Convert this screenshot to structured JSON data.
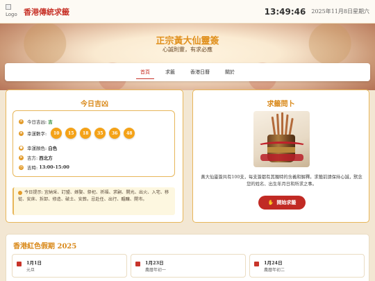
{
  "header": {
    "logo_alt": "Logo",
    "site_title": "香港傳統求籤",
    "time": "13:49:46",
    "date": "2025年11月8日星期六"
  },
  "hero": {
    "title": "正宗黃大仙靈簽",
    "subtitle": "心誠則靈，有求必應"
  },
  "nav": {
    "items": [
      "首頁",
      "求籤",
      "香港日曆",
      "關於"
    ],
    "active_index": 0
  },
  "fortune": {
    "title": "今日吉凶",
    "luck_label": "今日吉凶:",
    "luck_value": "吉",
    "numbers_label": "幸運數字:",
    "numbers": [
      "10",
      "15",
      "18",
      "35",
      "36",
      "48"
    ],
    "color_label": "幸運顏色:",
    "color_value": "白色",
    "direction_label": "吉方:",
    "direction_value": "西北方",
    "hour_label": "吉時:",
    "hour_value": "13:00-15:00",
    "tip": "今日提示: 宜納采、訂盟、嫁娶、祭祀、祈福、求嗣、開光、出火、入宅、移徙、安床、拆卸、修造、破土、安葬。忌赴任、出行、醞釀、開市。"
  },
  "lots": {
    "title": "求籤問卜",
    "image_label": "fortune-sticks-cup",
    "description": "黃大仙靈簽共有100支，每支簽都有其獨特的含義和解釋。求籤前請保持心誠，默念您的姓名、出生年月日和所求之事。",
    "button_label": "開始求籤"
  },
  "holidays": {
    "title": "香港紅色假期 2025",
    "items": [
      {
        "date": "1月1日",
        "name": "元旦"
      },
      {
        "date": "1月23日",
        "name": "農曆年初一"
      },
      {
        "date": "1月24日",
        "name": "農曆年初二"
      }
    ]
  },
  "colors": {
    "accent_red": "#c8342a",
    "accent_gold": "#d9891a",
    "ball_orange": "#f4a218",
    "border_gold": "#e7b659"
  }
}
